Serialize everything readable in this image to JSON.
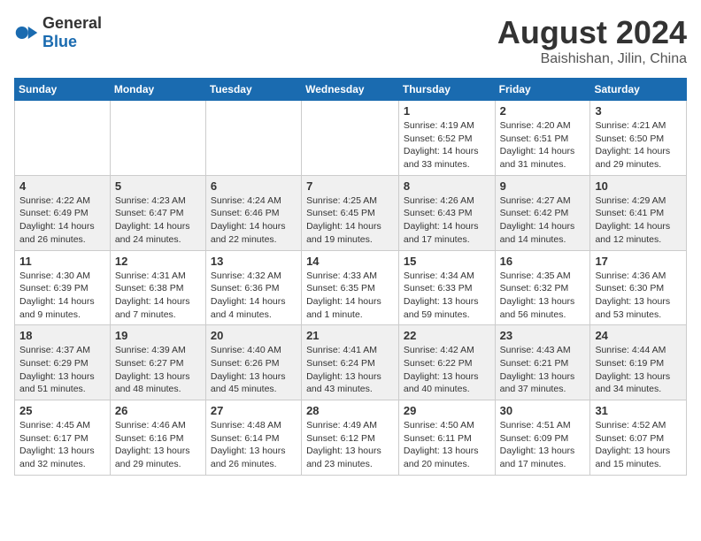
{
  "header": {
    "logo_general": "General",
    "logo_blue": "Blue",
    "title": "August 2024",
    "location": "Baishishan, Jilin, China"
  },
  "days_of_week": [
    "Sunday",
    "Monday",
    "Tuesday",
    "Wednesday",
    "Thursday",
    "Friday",
    "Saturday"
  ],
  "weeks": [
    [
      {
        "day": "",
        "info": ""
      },
      {
        "day": "",
        "info": ""
      },
      {
        "day": "",
        "info": ""
      },
      {
        "day": "",
        "info": ""
      },
      {
        "day": "1",
        "info": "Sunrise: 4:19 AM\nSunset: 6:52 PM\nDaylight: 14 hours and 33 minutes."
      },
      {
        "day": "2",
        "info": "Sunrise: 4:20 AM\nSunset: 6:51 PM\nDaylight: 14 hours and 31 minutes."
      },
      {
        "day": "3",
        "info": "Sunrise: 4:21 AM\nSunset: 6:50 PM\nDaylight: 14 hours and 29 minutes."
      }
    ],
    [
      {
        "day": "4",
        "info": "Sunrise: 4:22 AM\nSunset: 6:49 PM\nDaylight: 14 hours and 26 minutes."
      },
      {
        "day": "5",
        "info": "Sunrise: 4:23 AM\nSunset: 6:47 PM\nDaylight: 14 hours and 24 minutes."
      },
      {
        "day": "6",
        "info": "Sunrise: 4:24 AM\nSunset: 6:46 PM\nDaylight: 14 hours and 22 minutes."
      },
      {
        "day": "7",
        "info": "Sunrise: 4:25 AM\nSunset: 6:45 PM\nDaylight: 14 hours and 19 minutes."
      },
      {
        "day": "8",
        "info": "Sunrise: 4:26 AM\nSunset: 6:43 PM\nDaylight: 14 hours and 17 minutes."
      },
      {
        "day": "9",
        "info": "Sunrise: 4:27 AM\nSunset: 6:42 PM\nDaylight: 14 hours and 14 minutes."
      },
      {
        "day": "10",
        "info": "Sunrise: 4:29 AM\nSunset: 6:41 PM\nDaylight: 14 hours and 12 minutes."
      }
    ],
    [
      {
        "day": "11",
        "info": "Sunrise: 4:30 AM\nSunset: 6:39 PM\nDaylight: 14 hours and 9 minutes."
      },
      {
        "day": "12",
        "info": "Sunrise: 4:31 AM\nSunset: 6:38 PM\nDaylight: 14 hours and 7 minutes."
      },
      {
        "day": "13",
        "info": "Sunrise: 4:32 AM\nSunset: 6:36 PM\nDaylight: 14 hours and 4 minutes."
      },
      {
        "day": "14",
        "info": "Sunrise: 4:33 AM\nSunset: 6:35 PM\nDaylight: 14 hours and 1 minute."
      },
      {
        "day": "15",
        "info": "Sunrise: 4:34 AM\nSunset: 6:33 PM\nDaylight: 13 hours and 59 minutes."
      },
      {
        "day": "16",
        "info": "Sunrise: 4:35 AM\nSunset: 6:32 PM\nDaylight: 13 hours and 56 minutes."
      },
      {
        "day": "17",
        "info": "Sunrise: 4:36 AM\nSunset: 6:30 PM\nDaylight: 13 hours and 53 minutes."
      }
    ],
    [
      {
        "day": "18",
        "info": "Sunrise: 4:37 AM\nSunset: 6:29 PM\nDaylight: 13 hours and 51 minutes."
      },
      {
        "day": "19",
        "info": "Sunrise: 4:39 AM\nSunset: 6:27 PM\nDaylight: 13 hours and 48 minutes."
      },
      {
        "day": "20",
        "info": "Sunrise: 4:40 AM\nSunset: 6:26 PM\nDaylight: 13 hours and 45 minutes."
      },
      {
        "day": "21",
        "info": "Sunrise: 4:41 AM\nSunset: 6:24 PM\nDaylight: 13 hours and 43 minutes."
      },
      {
        "day": "22",
        "info": "Sunrise: 4:42 AM\nSunset: 6:22 PM\nDaylight: 13 hours and 40 minutes."
      },
      {
        "day": "23",
        "info": "Sunrise: 4:43 AM\nSunset: 6:21 PM\nDaylight: 13 hours and 37 minutes."
      },
      {
        "day": "24",
        "info": "Sunrise: 4:44 AM\nSunset: 6:19 PM\nDaylight: 13 hours and 34 minutes."
      }
    ],
    [
      {
        "day": "25",
        "info": "Sunrise: 4:45 AM\nSunset: 6:17 PM\nDaylight: 13 hours and 32 minutes."
      },
      {
        "day": "26",
        "info": "Sunrise: 4:46 AM\nSunset: 6:16 PM\nDaylight: 13 hours and 29 minutes."
      },
      {
        "day": "27",
        "info": "Sunrise: 4:48 AM\nSunset: 6:14 PM\nDaylight: 13 hours and 26 minutes."
      },
      {
        "day": "28",
        "info": "Sunrise: 4:49 AM\nSunset: 6:12 PM\nDaylight: 13 hours and 23 minutes."
      },
      {
        "day": "29",
        "info": "Sunrise: 4:50 AM\nSunset: 6:11 PM\nDaylight: 13 hours and 20 minutes."
      },
      {
        "day": "30",
        "info": "Sunrise: 4:51 AM\nSunset: 6:09 PM\nDaylight: 13 hours and 17 minutes."
      },
      {
        "day": "31",
        "info": "Sunrise: 4:52 AM\nSunset: 6:07 PM\nDaylight: 13 hours and 15 minutes."
      }
    ]
  ]
}
